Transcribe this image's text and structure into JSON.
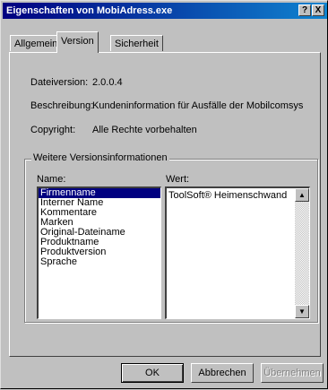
{
  "window": {
    "title": "Eigenschaften von MobiAdress.exe",
    "help_glyph": "?",
    "close_glyph": "X"
  },
  "tabs": [
    {
      "label": "Allgemein",
      "active": false
    },
    {
      "label": "Version",
      "active": true
    },
    {
      "label": "Sicherheit",
      "active": false
    }
  ],
  "info": {
    "file_version_label": "Dateiversion:",
    "file_version_value": "2.0.0.4",
    "description_label": "Beschreibung:",
    "description_value": "Kundeninformation für Ausfälle der Mobilcomsys",
    "copyright_label": "Copyright:",
    "copyright_value": "Alle Rechte vorbehalten"
  },
  "group": {
    "title": "Weitere Versionsinformationen",
    "name_header": "Name:",
    "value_header": "Wert:",
    "names": [
      "Firmenname",
      "Interner Name",
      "Kommentare",
      "Marken",
      "Original-Dateiname",
      "Produktname",
      "Produktversion",
      "Sprache"
    ],
    "selected_index": 0,
    "value_text": "ToolSoft® Heimenschwand"
  },
  "scrollbar": {
    "up_glyph": "▲",
    "down_glyph": "▼"
  },
  "buttons": {
    "ok": "OK",
    "cancel": "Abbrechen",
    "apply": "Übernehmen"
  }
}
